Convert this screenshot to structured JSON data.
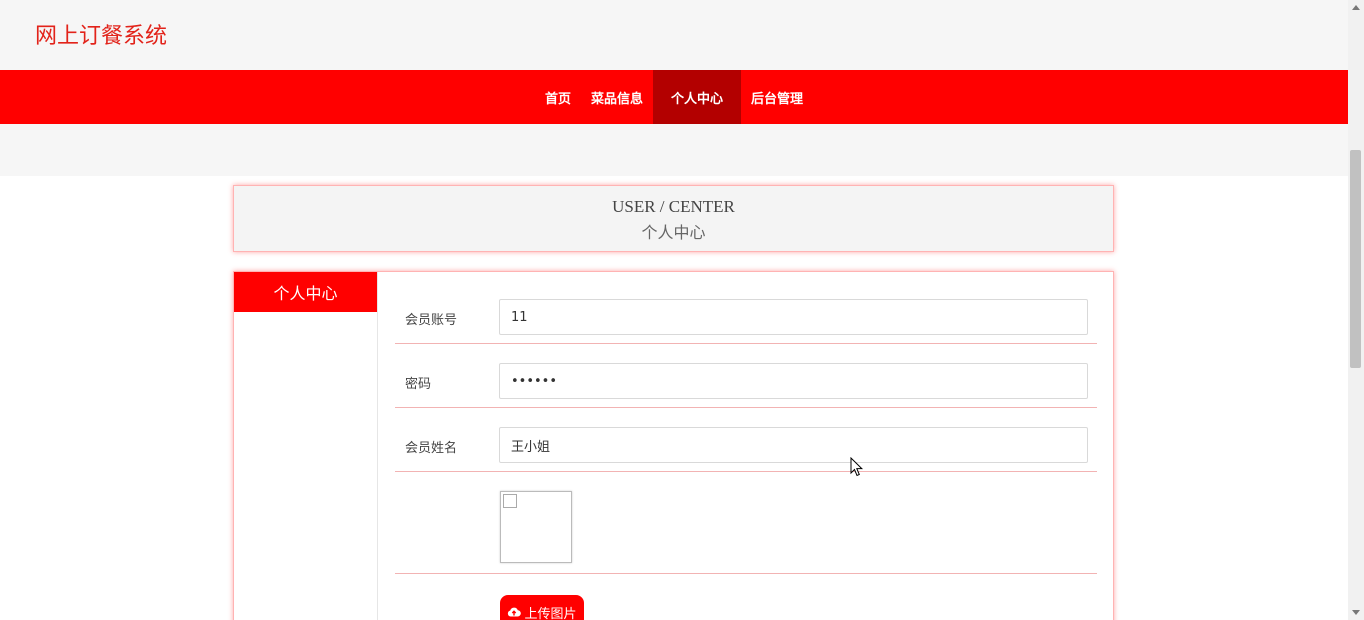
{
  "site": {
    "title": "网上订餐系统"
  },
  "nav": {
    "items": [
      {
        "label": "首页",
        "active": false
      },
      {
        "label": "菜品信息",
        "active": false
      },
      {
        "label": "个人中心",
        "active": true
      },
      {
        "label": "后台管理",
        "active": false
      }
    ]
  },
  "header": {
    "en": "USER / CENTER",
    "cn": "个人中心"
  },
  "sidebar": {
    "title": "个人中心"
  },
  "form": {
    "account": {
      "label": "会员账号",
      "value": "11"
    },
    "password": {
      "label": "密码",
      "value": "••••••"
    },
    "name": {
      "label": "会员姓名",
      "value": "王小姐"
    },
    "upload_label": "上传图片"
  },
  "colors": {
    "accent": "#ff0000",
    "active_nav": "#b30000",
    "title": "#e2231a"
  },
  "icons": {
    "upload": "cloud-upload-icon",
    "cursor": "mouse-pointer-icon"
  }
}
